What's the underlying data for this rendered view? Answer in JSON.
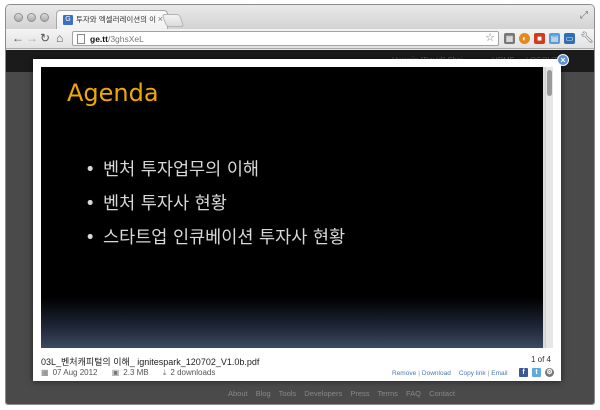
{
  "browser": {
    "tab_title": "투자와 엑셀러레이션의 이해 - G",
    "tab_favicon": "G",
    "url_host": "ge.tt",
    "url_path": "/3ghsXeL"
  },
  "site": {
    "user_name": "Hwanjin \"David\" Choi",
    "home_label": "HOME",
    "logout_label": "LOGOUT",
    "footer_links": [
      "About",
      "Blog",
      "Tools",
      "Developers",
      "Press",
      "Terms",
      "FAQ",
      "Contact"
    ]
  },
  "slide": {
    "title": "Agenda",
    "bullets": [
      "벤처 투자업무의 이해",
      "벤처 투자사 현황",
      "스타트업 인큐베이션 투자사 현황"
    ],
    "colors": {
      "title": "#f0a800",
      "background": "#000000"
    }
  },
  "file": {
    "name": "03L_벤처캐피털의 이해_ ignitespark_120702_V1.0b.pdf",
    "page_indicator": "1 of 4",
    "date": "07 Aug 2012",
    "size": "2.3 MB",
    "downloads": "2 downloads",
    "actions": {
      "remove": "Remove",
      "download": "Download",
      "copy_link": "Copy link",
      "email": "Email"
    }
  },
  "icons": [
    "back-arrow-icon",
    "forward-arrow-icon",
    "reload-icon",
    "home-icon",
    "star-icon",
    "wrench-icon",
    "close-icon",
    "calendar-icon",
    "disk-icon",
    "download-icon",
    "facebook-icon",
    "twitter-icon",
    "gear-icon"
  ]
}
